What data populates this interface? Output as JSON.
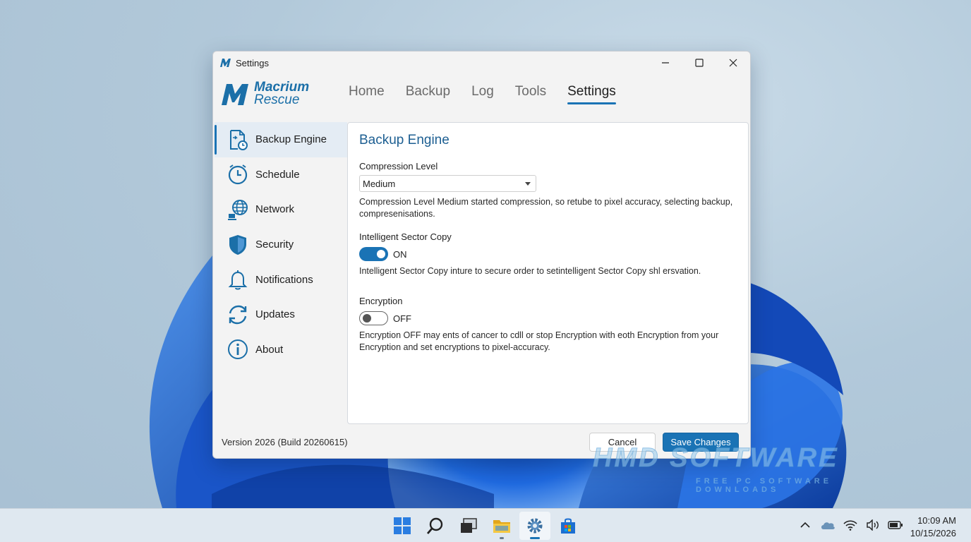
{
  "window": {
    "title": "Settings",
    "logo_line1": "Macrium",
    "logo_line2": "Rescue"
  },
  "nav": {
    "items": [
      "Home",
      "Backup",
      "Log",
      "Tools",
      "Settings"
    ],
    "active": "Settings"
  },
  "sidebar": {
    "items": [
      {
        "label": "Backup Engine",
        "icon": "backup-engine-icon",
        "active": true
      },
      {
        "label": "Schedule",
        "icon": "clock-icon"
      },
      {
        "label": "Network",
        "icon": "globe-network-icon"
      },
      {
        "label": "Security",
        "icon": "shield-icon"
      },
      {
        "label": "Notifications",
        "icon": "bell-icon"
      },
      {
        "label": "Updates",
        "icon": "refresh-icon"
      },
      {
        "label": "About",
        "icon": "info-icon"
      }
    ]
  },
  "content": {
    "heading": "Backup Engine",
    "compression": {
      "label": "Compression Level",
      "value": "Medium",
      "description": "Compression Level Medium started compression, so retube to pixel accuracy, selecting backup, compresenisations."
    },
    "sector_copy": {
      "label": "Intelligent Sector Copy",
      "state": "ON",
      "enabled": true,
      "description": "Intelligent Sector Copy inture to secure order to setintelligent Sector Copy shl ersvation."
    },
    "encryption": {
      "label": "Encryption",
      "state": "OFF",
      "enabled": false,
      "description": "Encryption OFF may ents of cancer to cdll or stop Encryption with eoth Encryption from your Encryption and set encryptions to pixel-accuracy."
    }
  },
  "footer": {
    "version": "Version 2026 (Build 20260615)",
    "cancel_label": "Cancel",
    "save_label": "Save Changes"
  },
  "watermark": {
    "main": "HMD SOFTWARE",
    "sub": "FREE PC SOFTWARE DOWNLOADS"
  },
  "taskbar": {
    "apps": [
      "start-icon",
      "search-icon",
      "task-view-icon",
      "file-explorer-icon",
      "settings-gear-icon",
      "store-icon"
    ],
    "active_app": "settings-gear-icon",
    "tray": [
      "chevron-up-icon",
      "onedrive-cloud-icon",
      "wifi-icon",
      "volume-icon",
      "battery-icon"
    ],
    "time": "10:09 AM",
    "date": "10/15/2026"
  },
  "colors": {
    "accent": "#1a73b5",
    "heading": "#1d5f92",
    "wallpaper_bloom": "#1b5fd6"
  }
}
